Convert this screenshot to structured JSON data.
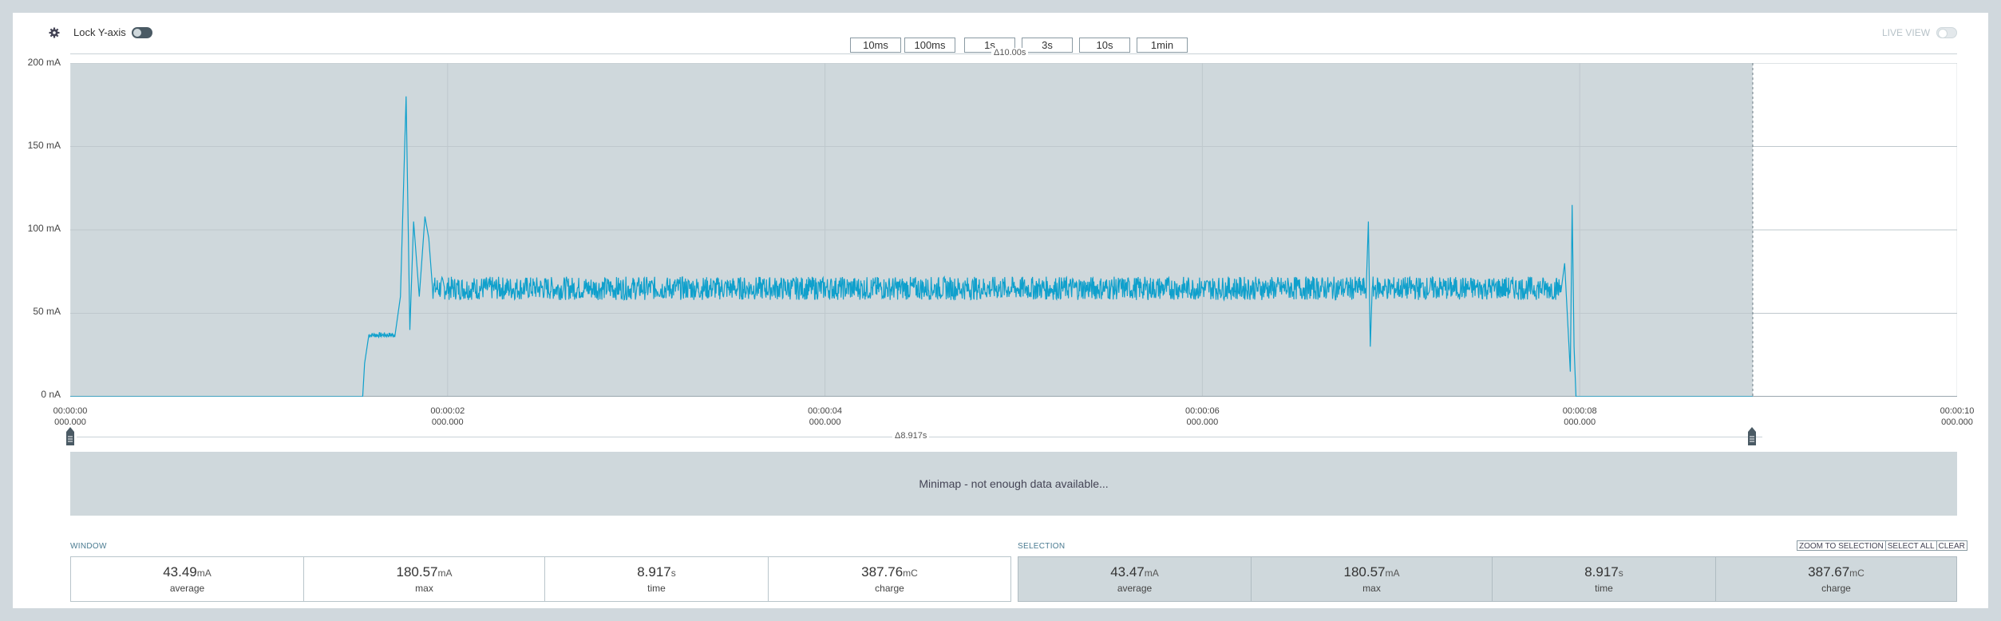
{
  "toolbar": {
    "lock_y_label": "Lock Y-axis",
    "time_buttons": [
      "10ms",
      "100ms",
      "1s",
      "3s",
      "10s",
      "1min"
    ],
    "live_view_label": "LIVE VIEW"
  },
  "chart": {
    "top_span": "Δ10.00s",
    "selection_span": "Δ8.917s",
    "y_ticks": [
      "200 mA",
      "150 mA",
      "100 mA",
      "50 mA",
      "0 nA"
    ],
    "x_ticks": [
      {
        "t": "00:00:00",
        "ms": "000.000"
      },
      {
        "t": "00:00:02",
        "ms": "000.000"
      },
      {
        "t": "00:00:04",
        "ms": "000.000"
      },
      {
        "t": "00:00:06",
        "ms": "000.000"
      },
      {
        "t": "00:00:08",
        "ms": "000.000"
      },
      {
        "t": "00:00:10",
        "ms": "000.000"
      }
    ],
    "line_color": "#0fa0cc"
  },
  "chart_data": {
    "type": "line",
    "xlabel": "",
    "ylabel": "",
    "x_unit": "s",
    "y_unit": "mA",
    "xlim": [
      0,
      10
    ],
    "ylim": [
      0,
      200
    ],
    "selection": [
      0,
      8.917
    ],
    "series": [
      {
        "values": [
          [
            0,
            0
          ],
          [
            1.55,
            0
          ],
          [
            1.56,
            20
          ],
          [
            1.58,
            35
          ],
          [
            1.6,
            37
          ],
          [
            1.7,
            37
          ],
          [
            1.72,
            38
          ],
          [
            1.75,
            60
          ],
          [
            1.78,
            180
          ],
          [
            1.8,
            40
          ],
          [
            1.82,
            105
          ],
          [
            1.85,
            60
          ],
          [
            1.88,
            108
          ],
          [
            1.9,
            95
          ],
          [
            1.92,
            65
          ],
          [
            2.5,
            65
          ],
          [
            3.0,
            65
          ],
          [
            3.5,
            65
          ],
          [
            4.0,
            65
          ],
          [
            4.5,
            65
          ],
          [
            5.0,
            65
          ],
          [
            5.5,
            65
          ],
          [
            6.0,
            65
          ],
          [
            6.5,
            65
          ],
          [
            6.87,
            65
          ],
          [
            6.88,
            105
          ],
          [
            6.89,
            30
          ],
          [
            6.9,
            65
          ],
          [
            7.5,
            65
          ],
          [
            7.9,
            65
          ],
          [
            7.92,
            80
          ],
          [
            7.95,
            15
          ],
          [
            7.96,
            115
          ],
          [
            7.97,
            30
          ],
          [
            7.98,
            0
          ],
          [
            8.917,
            0
          ]
        ]
      }
    ]
  },
  "minimap": {
    "text": "Minimap - not enough data available..."
  },
  "window_section": {
    "title": "WINDOW",
    "stats": [
      {
        "value": "43.49",
        "unit": "mA",
        "label": "average"
      },
      {
        "value": "180.57",
        "unit": "mA",
        "label": "max"
      },
      {
        "value": "8.917",
        "unit": "s",
        "label": "time"
      },
      {
        "value": "387.76",
        "unit": "mC",
        "label": "charge"
      }
    ]
  },
  "selection_section": {
    "title": "SELECTION",
    "buttons": [
      "ZOOM TO SELECTION",
      "SELECT ALL",
      "CLEAR"
    ],
    "stats": [
      {
        "value": "43.47",
        "unit": "mA",
        "label": "average"
      },
      {
        "value": "180.57",
        "unit": "mA",
        "label": "max"
      },
      {
        "value": "8.917",
        "unit": "s",
        "label": "time"
      },
      {
        "value": "387.67",
        "unit": "mC",
        "label": "charge"
      }
    ]
  }
}
